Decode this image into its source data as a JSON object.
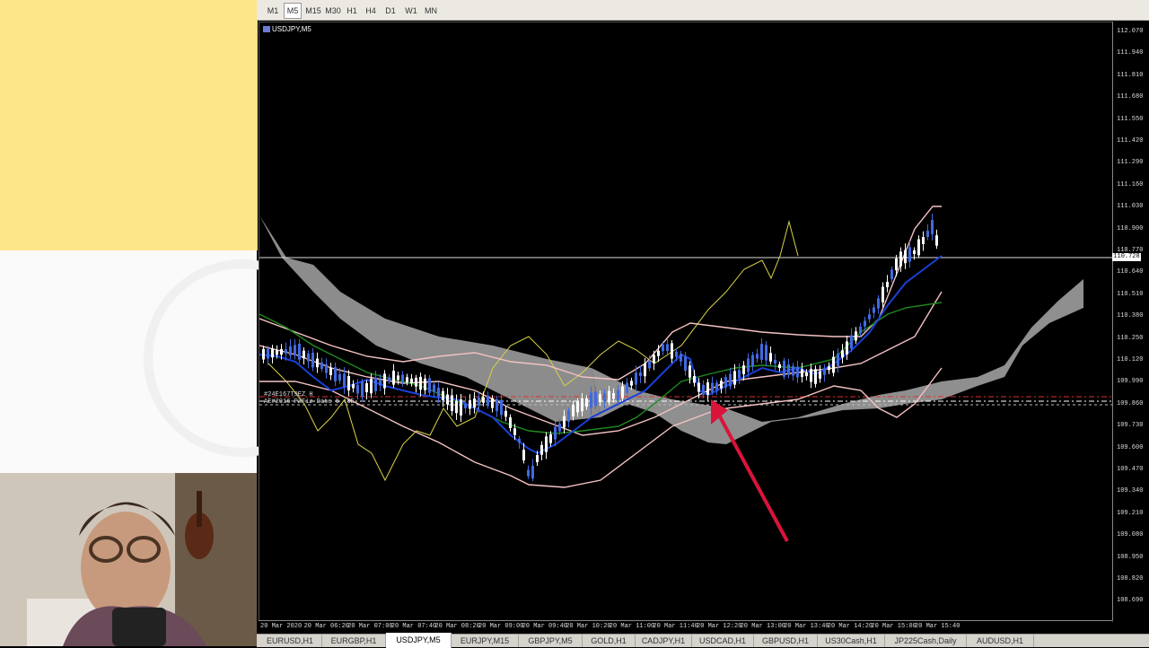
{
  "timeframes": [
    "M1",
    "M5",
    "M15",
    "M30",
    "H1",
    "H4",
    "D1",
    "W1",
    "MN"
  ],
  "active_timeframe": "M5",
  "chart": {
    "symbol": "USDJPY,M5",
    "current_price": "110.728",
    "order_label": "#24E167T9EZ H",
    "order_label2": "AE#2016-PZFiz Date 5 .8E",
    "price_ticks": [
      "112.070",
      "111.940",
      "111.810",
      "111.680",
      "111.550",
      "111.420",
      "111.290",
      "111.160",
      "111.030",
      "110.900",
      "110.770",
      "110.640",
      "110.510",
      "110.380",
      "110.250",
      "110.120",
      "109.990",
      "109.860",
      "109.730",
      "109.600",
      "109.470",
      "109.340",
      "109.210",
      "109.080",
      "108.950",
      "108.820",
      "108.690"
    ],
    "time_ticks": [
      "20 Mar 2020",
      "20 Mar 06:20",
      "20 Mar 07:00",
      "20 Mar 07:40",
      "20 Mar 08:20",
      "20 Mar 09:00",
      "20 Mar 09:40",
      "20 Mar 10:20",
      "20 Mar 11:00",
      "20 Mar 11:40",
      "20 Mar 12:20",
      "20 Mar 13:00",
      "20 Mar 13:40",
      "20 Mar 14:20",
      "20 Mar 15:00",
      "20 Mar 15:40"
    ]
  },
  "tabs": [
    "EURUSD,H1",
    "EURGBP,H1",
    "USDJPY,M5",
    "EURJPY,M15",
    "GBPJPY,M5",
    "GOLD,H1",
    "CADJPY,H1",
    "USDCAD,H1",
    "GBPUSD,H1",
    "US30Cash,H1",
    "JP225Cash,Daily",
    "AUDUSD,H1"
  ],
  "active_tab": "USDJPY,M5",
  "colors": {
    "sticky_note": "#fde68a",
    "candle_up": "#ffffff",
    "candle_down": "#4169e1",
    "kijun": "#1a3fd6",
    "tenkan": "#1f8a1f",
    "chikou": "#d8d24a",
    "bollinger": "#f4c2c2",
    "cloud": "#8c8c8c",
    "annotation_arrow": "#d9143a"
  }
}
